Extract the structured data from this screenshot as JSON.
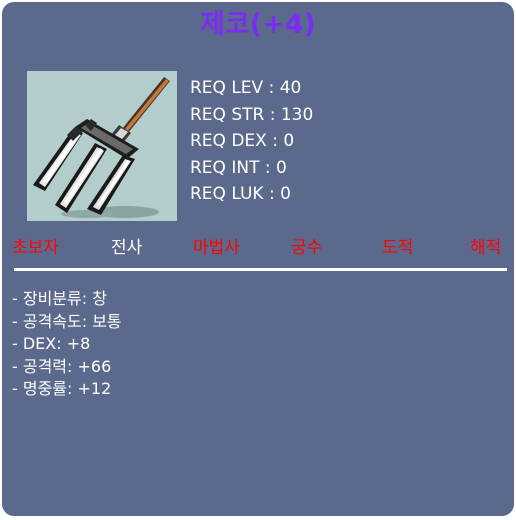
{
  "item": {
    "name": "제코(+4)",
    "name_color": "#7b2cf0",
    "icon": "trident-weapon-icon"
  },
  "requirements": [
    "REQ LEV : 40",
    "REQ STR : 130",
    "REQ DEX : 0",
    "REQ INT : 0",
    "REQ LUK : 0"
  ],
  "jobs": [
    {
      "label": "초보자",
      "eligible": false,
      "color": "#ff0000"
    },
    {
      "label": "전사",
      "eligible": true,
      "color": "#ffffff"
    },
    {
      "label": "마법사",
      "eligible": false,
      "color": "#ff0000"
    },
    {
      "label": "궁수",
      "eligible": false,
      "color": "#ff0000"
    },
    {
      "label": "도적",
      "eligible": false,
      "color": "#ff0000"
    },
    {
      "label": "해적",
      "eligible": false,
      "color": "#ff0000"
    }
  ],
  "stats": [
    "- 장비분류: 창",
    "- 공격속도: 보통",
    "- DEX: +8",
    "- 공격력: +66",
    "- 명중률: +12"
  ],
  "colors": {
    "background": "#5b6a8c",
    "icon_background": "#b3cccc",
    "unavailable": "#ff0000",
    "available": "#ffffff"
  }
}
